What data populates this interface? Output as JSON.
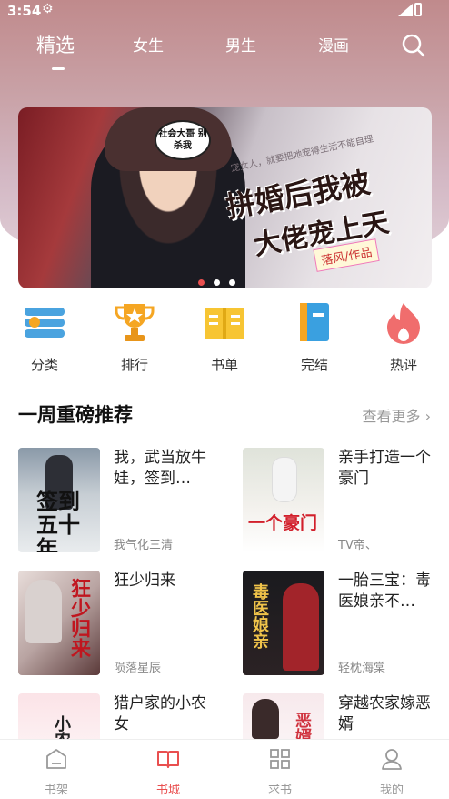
{
  "status": {
    "time": "3:54"
  },
  "tabs": [
    {
      "label": "精选",
      "active": true
    },
    {
      "label": "女生",
      "active": false
    },
    {
      "label": "男生",
      "active": false
    },
    {
      "label": "漫画",
      "active": false
    }
  ],
  "banner": {
    "bubble": "社会大哥 别杀我",
    "slogan": "宠女人，就要把她宠得生活不能自理",
    "title_line1": "拼婚后我被",
    "title_line2": "大佬宠上天",
    "author": "落风/作品",
    "page_count": 3,
    "active_page": 1
  },
  "categories": [
    {
      "label": "分类",
      "icon": "list-icon"
    },
    {
      "label": "排行",
      "icon": "trophy-icon"
    },
    {
      "label": "书单",
      "icon": "open-book-icon"
    },
    {
      "label": "完结",
      "icon": "book-icon"
    },
    {
      "label": "热评",
      "icon": "flame-icon"
    }
  ],
  "section": {
    "title": "一周重磅推荐",
    "more": "查看更多"
  },
  "books": [
    {
      "title": "我，武当放牛娃，签到…",
      "author": "我气化三清",
      "cover_text": "签到五十年"
    },
    {
      "title": "亲手打造一个豪门",
      "author": "TV帝、",
      "cover_text": "一个豪门"
    },
    {
      "title": "狂少归来",
      "author": "陨落星辰",
      "cover_text": "狂少归来"
    },
    {
      "title": "一胎三宝：毒医娘亲不…",
      "author": "轻枕海棠",
      "cover_text": "毒医娘亲"
    },
    {
      "title": "猎户家的小农女",
      "author": "",
      "cover_text": "小农女"
    },
    {
      "title": "穿越农家嫁恶婿",
      "author": "",
      "cover_text": "恶婿"
    }
  ],
  "bottom_nav": [
    {
      "label": "书架",
      "icon": "bookshelf-icon",
      "active": false
    },
    {
      "label": "书城",
      "icon": "bookstore-icon",
      "active": true
    },
    {
      "label": "求书",
      "icon": "grid-icon",
      "active": false
    },
    {
      "label": "我的",
      "icon": "user-icon",
      "active": false
    }
  ],
  "colors": {
    "accent": "#e94f4f",
    "hero_top": "#c08a8c",
    "hero_bottom": "#e2d2da"
  }
}
